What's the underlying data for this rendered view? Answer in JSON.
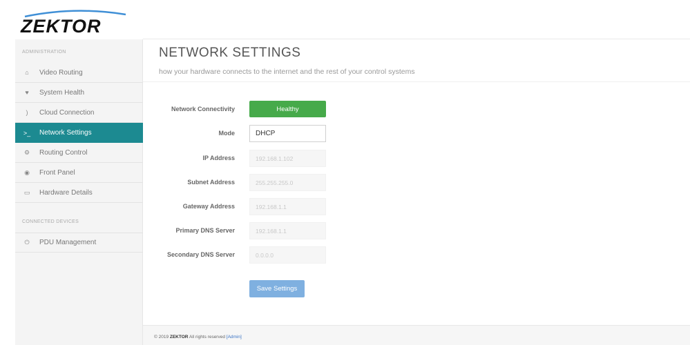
{
  "brand": {
    "logo_text": "ZEKTOR"
  },
  "sidebar": {
    "section_admin": "ADMINISTRATION",
    "items": [
      {
        "label": "Video Routing",
        "icon": "home-icon",
        "glyph": "⌂"
      },
      {
        "label": "System Health",
        "icon": "heart-icon",
        "glyph": "♥"
      },
      {
        "label": "Cloud Connection",
        "icon": "rss-icon",
        "glyph": ")"
      },
      {
        "label": "Network Settings",
        "icon": "terminal-icon",
        "glyph": ">_",
        "active": true
      },
      {
        "label": "Routing Control",
        "icon": "cogs-icon",
        "glyph": "⚙"
      },
      {
        "label": "Front Panel",
        "icon": "circle-dot-icon",
        "glyph": "◉"
      },
      {
        "label": "Hardware Details",
        "icon": "hdd-icon",
        "glyph": "▭"
      }
    ],
    "section_devices": "CONNECTED DEVICES",
    "device_items": [
      {
        "label": "PDU Management",
        "icon": "power-icon",
        "glyph": "⏻"
      }
    ]
  },
  "page": {
    "title": "NETWORK SETTINGS",
    "subtitle": "how your hardware connects to the internet and the rest of your control systems"
  },
  "form": {
    "connectivity_label": "Network Connectivity",
    "connectivity_status": "Healthy",
    "status_color": "#46aa4a",
    "mode_label": "Mode",
    "mode_value": "DHCP",
    "ip_label": "IP Address",
    "ip_value": "192.168.1.102",
    "subnet_label": "Subnet Address",
    "subnet_value": "255.255.255.0",
    "gateway_label": "Gateway Address",
    "gateway_value": "192.168.1.1",
    "dns1_label": "Primary DNS Server",
    "dns1_value": "192.168.1.1",
    "dns2_label": "Secondary DNS Server",
    "dns2_value": "0.0.0.0",
    "save_label": "Save Settings"
  },
  "footer": {
    "copyright": "© 2019",
    "brand": "ZEKTOR",
    "rights": "All rights reserved",
    "link_label": "[Admin]"
  },
  "colors": {
    "accent": "#1c8a91",
    "button": "#7fb0e0"
  }
}
